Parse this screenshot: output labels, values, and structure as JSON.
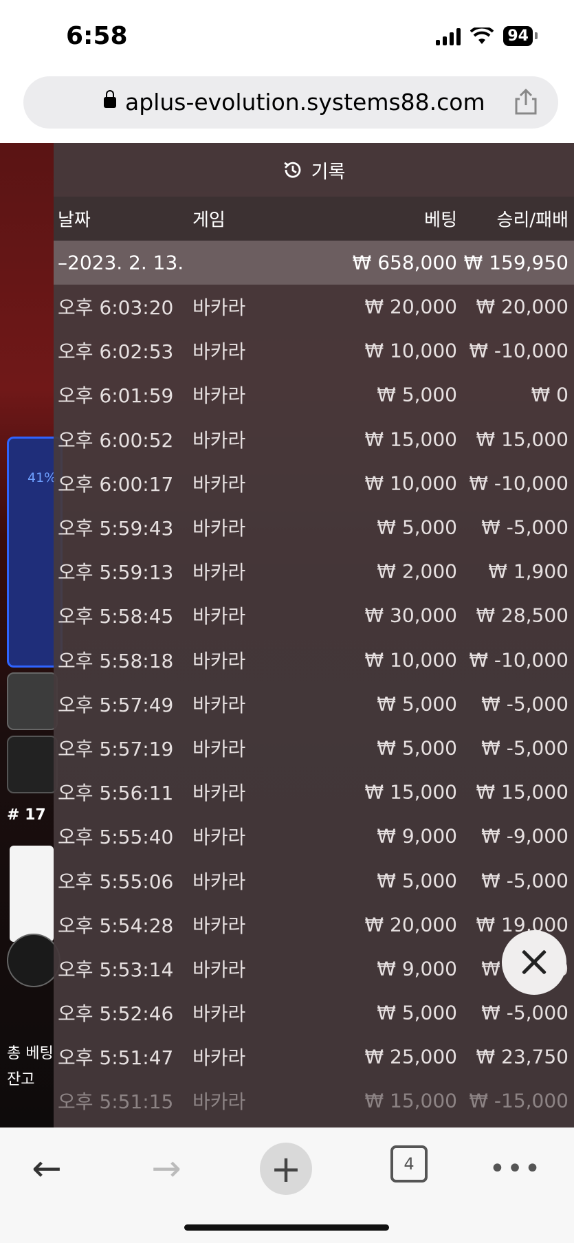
{
  "status_bar": {
    "time": "6:58",
    "battery": "94"
  },
  "browser": {
    "url": "aplus-evolution.systems88.com",
    "tab_count": "4"
  },
  "game_background": {
    "progress_label": "41%",
    "round_label": "# 17",
    "bet_label": "총 베팅",
    "balance_label": "잔고"
  },
  "history": {
    "title": "기록",
    "columns": {
      "date": "날짜",
      "game": "게임",
      "bet": "베팅",
      "win_loss": "승리/패배"
    },
    "date_group": {
      "date": "–2023. 2. 13.",
      "total_bet": "₩ 658,000",
      "total_result": "₩ 159,950"
    },
    "rows": [
      {
        "time": "오후 6:03:20",
        "game": "바카라",
        "bet": "₩ 20,000",
        "result": "₩ 20,000"
      },
      {
        "time": "오후 6:02:53",
        "game": "바카라",
        "bet": "₩ 10,000",
        "result": "₩ -10,000"
      },
      {
        "time": "오후 6:01:59",
        "game": "바카라",
        "bet": "₩ 5,000",
        "result": "₩ 0"
      },
      {
        "time": "오후 6:00:52",
        "game": "바카라",
        "bet": "₩ 15,000",
        "result": "₩ 15,000"
      },
      {
        "time": "오후 6:00:17",
        "game": "바카라",
        "bet": "₩ 10,000",
        "result": "₩ -10,000"
      },
      {
        "time": "오후 5:59:43",
        "game": "바카라",
        "bet": "₩ 5,000",
        "result": "₩ -5,000"
      },
      {
        "time": "오후 5:59:13",
        "game": "바카라",
        "bet": "₩ 2,000",
        "result": "₩ 1,900"
      },
      {
        "time": "오후 5:58:45",
        "game": "바카라",
        "bet": "₩ 30,000",
        "result": "₩ 28,500"
      },
      {
        "time": "오후 5:58:18",
        "game": "바카라",
        "bet": "₩ 10,000",
        "result": "₩ -10,000"
      },
      {
        "time": "오후 5:57:49",
        "game": "바카라",
        "bet": "₩ 5,000",
        "result": "₩ -5,000"
      },
      {
        "time": "오후 5:57:19",
        "game": "바카라",
        "bet": "₩ 5,000",
        "result": "₩ -5,000"
      },
      {
        "time": "오후 5:56:11",
        "game": "바카라",
        "bet": "₩ 15,000",
        "result": "₩ 15,000"
      },
      {
        "time": "오후 5:55:40",
        "game": "바카라",
        "bet": "₩ 9,000",
        "result": "₩ -9,000"
      },
      {
        "time": "오후 5:55:06",
        "game": "바카라",
        "bet": "₩ 5,000",
        "result": "₩ -5,000"
      },
      {
        "time": "오후 5:54:28",
        "game": "바카라",
        "bet": "₩ 20,000",
        "result": "₩ 19,000"
      },
      {
        "time": "오후 5:53:14",
        "game": "바카라",
        "bet": "₩ 9,000",
        "result": "₩ -9,000"
      },
      {
        "time": "오후 5:52:46",
        "game": "바카라",
        "bet": "₩ 5,000",
        "result": "₩ -5,000"
      },
      {
        "time": "오후 5:51:47",
        "game": "바카라",
        "bet": "₩ 25,000",
        "result": "₩ 23,750"
      },
      {
        "time": "오후 5:51:15",
        "game": "바카라",
        "bet": "₩ 15,000",
        "result": "₩ -15,000"
      }
    ]
  }
}
